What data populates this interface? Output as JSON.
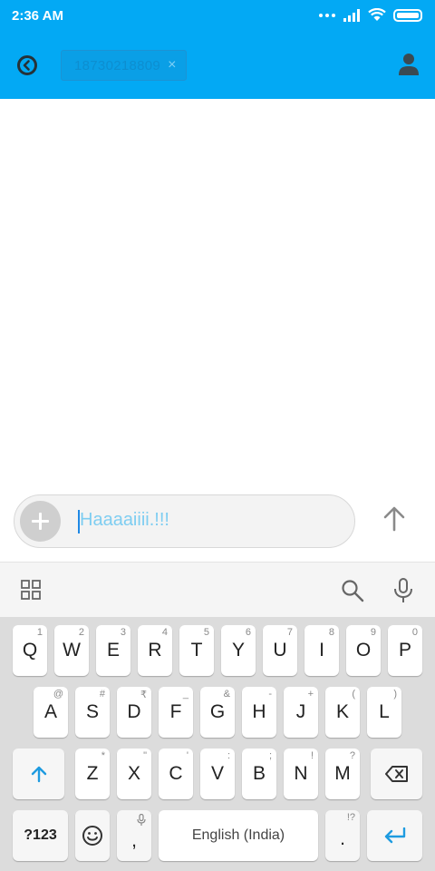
{
  "status_bar": {
    "time": "2:36 AM"
  },
  "header": {
    "recipient": "18730218809",
    "recipient_remove": "×"
  },
  "compose": {
    "message_text": "Haaaaiiii.!!!"
  },
  "keyboard": {
    "row1": [
      {
        "label": "Q",
        "hint": "1"
      },
      {
        "label": "W",
        "hint": "2"
      },
      {
        "label": "E",
        "hint": "3"
      },
      {
        "label": "R",
        "hint": "4"
      },
      {
        "label": "T",
        "hint": "5"
      },
      {
        "label": "Y",
        "hint": "6"
      },
      {
        "label": "U",
        "hint": "7"
      },
      {
        "label": "I",
        "hint": "8"
      },
      {
        "label": "O",
        "hint": "9"
      },
      {
        "label": "P",
        "hint": "0"
      }
    ],
    "row2": [
      {
        "label": "A",
        "hint": "@"
      },
      {
        "label": "S",
        "hint": "#"
      },
      {
        "label": "D",
        "hint": "₹"
      },
      {
        "label": "F",
        "hint": "_"
      },
      {
        "label": "G",
        "hint": "&"
      },
      {
        "label": "H",
        "hint": "-"
      },
      {
        "label": "J",
        "hint": "+"
      },
      {
        "label": "K",
        "hint": "("
      },
      {
        "label": "L",
        "hint": ")"
      }
    ],
    "row3": [
      {
        "label": "Z",
        "hint": "*"
      },
      {
        "label": "X",
        "hint": "\""
      },
      {
        "label": "C",
        "hint": "'"
      },
      {
        "label": "V",
        "hint": ":"
      },
      {
        "label": "B",
        "hint": ";"
      },
      {
        "label": "N",
        "hint": "!"
      },
      {
        "label": "M",
        "hint": "?"
      }
    ],
    "symbols_label": "?123",
    "comma_label": ",",
    "space_label": "English (India)",
    "period_label": ".",
    "period_hint": "!?",
    "shift_icon": "shift-arrow-up",
    "backspace_icon": "backspace",
    "emoji_icon": "smiley",
    "enter_icon": "enter-arrow",
    "accent_color": "#03a9f4"
  },
  "colors": {
    "header_bg": "#03a9f4",
    "input_text": "#7ecdf1",
    "keyboard_bg": "#dcdcdc"
  }
}
